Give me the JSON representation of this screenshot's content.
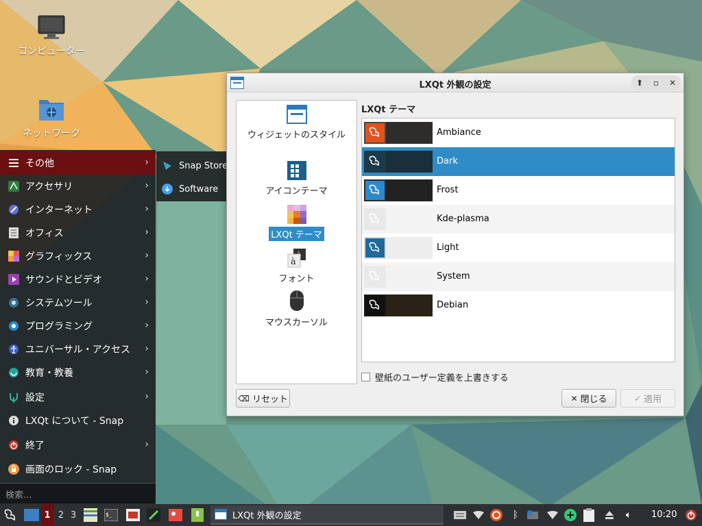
{
  "desktop": {
    "icons": [
      {
        "label": "コンピューター"
      },
      {
        "label": "ネットワーク"
      }
    ]
  },
  "app_menu": {
    "items": [
      {
        "label": "その他",
        "icon": "list-icon"
      },
      {
        "label": "アクセサリ",
        "icon": "accessories-icon"
      },
      {
        "label": "インターネット",
        "icon": "internet-icon"
      },
      {
        "label": "オフィス",
        "icon": "office-icon"
      },
      {
        "label": "グラフィックス",
        "icon": "graphics-icon"
      },
      {
        "label": "サウンドとビデオ",
        "icon": "multimedia-icon"
      },
      {
        "label": "システムツール",
        "icon": "system-tools-icon"
      },
      {
        "label": "プログラミング",
        "icon": "programming-icon"
      },
      {
        "label": "ユニバーサル・アクセス",
        "icon": "accessibility-icon"
      },
      {
        "label": "教育・教養",
        "icon": "education-icon"
      },
      {
        "label": "設定",
        "icon": "settings-icon"
      },
      {
        "label": "LXQt について - Snap",
        "icon": "info-icon"
      },
      {
        "label": "終了",
        "icon": "power-icon"
      },
      {
        "label": "画面のロック - Snap",
        "icon": "lock-icon"
      }
    ],
    "search_placeholder": "検索..."
  },
  "submenu": {
    "items": [
      {
        "label": "Snap Store",
        "icon": "snap-store-icon"
      },
      {
        "label": "Software",
        "icon": "software-icon"
      }
    ]
  },
  "dialog": {
    "title": "LXQt 外観の設定",
    "categories": [
      {
        "label": "ウィジェットのスタイル",
        "icon": "widget-style-icon"
      },
      {
        "label": "アイコンテーマ",
        "icon": "icon-theme-icon"
      },
      {
        "label": "LXQt テーマ",
        "icon": "lxqt-theme-icon",
        "selected": true
      },
      {
        "label": "フォント",
        "icon": "font-icon"
      },
      {
        "label": "マウスカーソル",
        "icon": "mouse-icon"
      }
    ],
    "section_heading": "LXQt テーマ",
    "themes": [
      {
        "name": "Ambiance",
        "colors": [
          "#4a4644",
          "#2f2d2b"
        ],
        "badge": "#e0531f"
      },
      {
        "name": "Dark",
        "colors": [
          "#1d3a4a",
          "#1a2f3c"
        ],
        "badge": "#1d3a4a",
        "selected": true
      },
      {
        "name": "Frost",
        "colors": [
          "#2a2a2a",
          "#222222"
        ],
        "badge": "#2a8ad0"
      },
      {
        "name": "Kde-plasma",
        "colors": [
          "#e8e8e8",
          "#f3f3f3"
        ],
        "badge": "#e8e8e8"
      },
      {
        "name": "Light",
        "colors": [
          "#d8d8d8",
          "#ededed"
        ],
        "badge": "#1f6a99"
      },
      {
        "name": "System",
        "colors": [
          "#e9e9e9",
          "#f2f2f2"
        ],
        "badge": "#e9e9e9"
      },
      {
        "name": "Debian",
        "colors": [
          "#1c1712",
          "#2a2215"
        ],
        "badge": "#111111"
      }
    ],
    "override_wallpaper_label": "壁紙のユーザー定義を上書きする",
    "reset_label": "リセット",
    "close_label": "閉じる",
    "apply_label": "適用"
  },
  "taskbar": {
    "desktops": [
      "1",
      "2",
      "3"
    ],
    "current_desktop": "1",
    "task_label": "LXQt 外観の設定",
    "clock": "10:20"
  },
  "colors": {
    "accent": "#308cc6",
    "menu_active": "#6b0f12"
  }
}
